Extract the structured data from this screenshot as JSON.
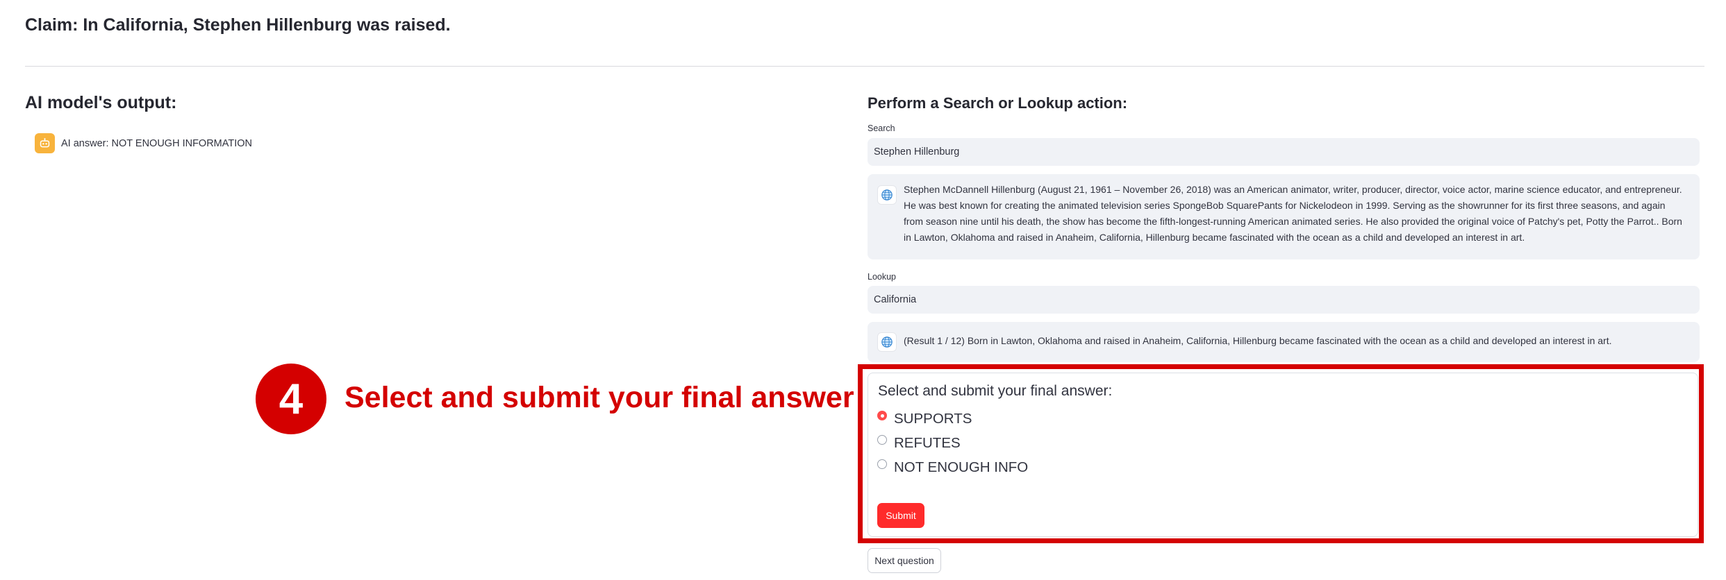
{
  "claim": "Claim: In California, Stephen Hillenburg was raised.",
  "left": {
    "heading": "AI model's output:",
    "ai_answer": "AI answer: NOT ENOUGH INFORMATION",
    "avatar_icon": "robot-icon"
  },
  "right": {
    "heading": "Perform a Search or Lookup action:",
    "search": {
      "label": "Search",
      "value": "Stephen Hillenburg",
      "result": "Stephen McDannell Hillenburg (August 21, 1961 – November 26, 2018) was an American animator, writer, producer, director, voice actor, marine science educator, and entrepreneur. He was best known for creating the animated television series SpongeBob SquarePants for Nickelodeon in 1999. Serving as the showrunner for its first three seasons, and again from season nine until his death, the show has become the fifth-longest-running American animated series. He also provided the original voice of Patchy's pet, Potty the Parrot.. Born in Lawton, Oklahoma and raised in Anaheim, California, Hillenburg became fascinated with the ocean as a child and developed an interest in art."
    },
    "lookup": {
      "label": "Lookup",
      "value": "California",
      "result": "(Result 1 / 12) Born in Lawton, Oklahoma and raised in Anaheim, California, Hillenburg became fascinated with the ocean as a child and developed an interest in art."
    },
    "result_icon": "globe-icon"
  },
  "annotation": {
    "step": "4",
    "text": "Select and submit your final answer"
  },
  "form": {
    "title": "Select and submit your final answer:",
    "options": [
      "SUPPORTS",
      "REFUTES",
      "NOT ENOUGH INFO"
    ],
    "selected": "SUPPORTS",
    "submit_label": "Submit"
  },
  "next_label": "Next question",
  "colors": {
    "accent": "#ff4b4b",
    "annotation_red": "#d40000",
    "avatar_bg": "#f8b33c",
    "input_bg": "#f0f2f6"
  }
}
